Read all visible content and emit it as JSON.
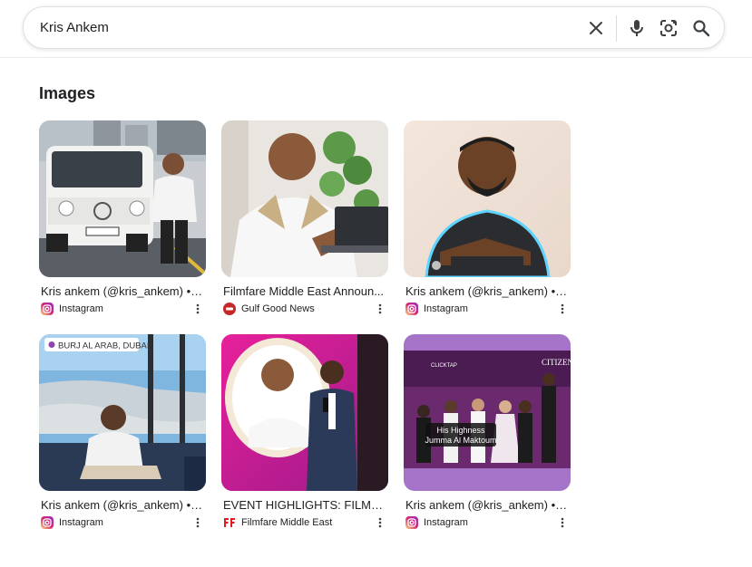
{
  "search": {
    "query": "Kris Ankem",
    "clear_icon": "close-icon",
    "voice_icon": "mic-icon",
    "lens_icon": "camera-lens-icon",
    "search_icon": "search-icon"
  },
  "images_section": {
    "title": "Images",
    "results": [
      {
        "title": "Kris ankem (@kris_ankem) • I...",
        "source": "Instagram",
        "favicon": "instagram-icon"
      },
      {
        "title": "Filmfare Middle East Announ...",
        "source": "Gulf Good News",
        "favicon": "gulf-good-news-icon"
      },
      {
        "title": "Kris ankem (@kris_ankem) • I...",
        "source": "Instagram",
        "favicon": "instagram-icon"
      },
      {
        "title": "Kris ankem (@kris_ankem) • I...",
        "source": "Instagram",
        "favicon": "instagram-icon",
        "overlay_label": "BURJ AL ARAB, DUBAI"
      },
      {
        "title": "EVENT HIGHLIGHTS: FILMF...",
        "source": "Filmfare Middle East",
        "favicon": "filmfare-icon"
      },
      {
        "title": "Kris ankem (@kris_ankem) • I...",
        "source": "Instagram",
        "favicon": "instagram-icon",
        "overlay_caption_1": "His Highness",
        "overlay_caption_2": "Jumma Al Maktoum",
        "overlay_brand_1": "CITIZEN",
        "overlay_brand_2": "CLICKTAP"
      }
    ]
  },
  "colors": {
    "text": "#202124",
    "border": "#dfe1e5",
    "icon": "#3c4043",
    "instagram_gradient": [
      "#feda75",
      "#d62976",
      "#962fbf"
    ],
    "filmfare_red": "#e21b22"
  }
}
